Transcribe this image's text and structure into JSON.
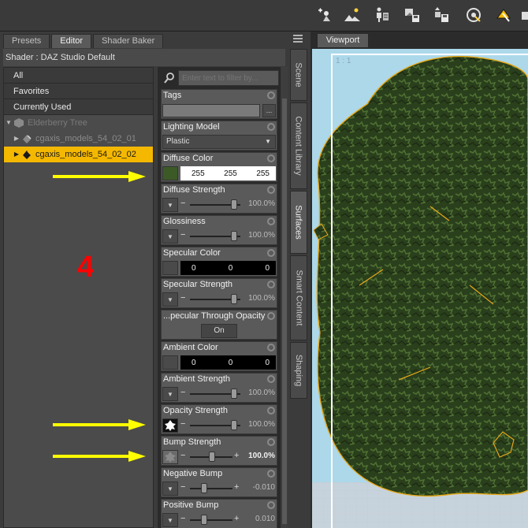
{
  "tabs": [
    {
      "label": "Presets"
    },
    {
      "label": "Editor"
    },
    {
      "label": "Shader Baker"
    }
  ],
  "shader_title": "Shader : DAZ Studio Default",
  "categories": [
    {
      "label": "All"
    },
    {
      "label": "Favorites"
    },
    {
      "label": "Currently Used"
    }
  ],
  "tree": [
    {
      "label": "Elderberry Tree"
    },
    {
      "label": "cgaxis_models_54_02_01"
    },
    {
      "label": "cgaxis_models_54_02_02"
    }
  ],
  "annotation_number": "4",
  "filter_placeholder": "Enter text to filter by...",
  "props": {
    "tags": {
      "label": "Tags",
      "button": "..."
    },
    "lighting_model": {
      "label": "Lighting Model",
      "value": "Plastic"
    },
    "diffuse_color": {
      "label": "Diffuse Color",
      "r": "255",
      "g": "255",
      "b": "255"
    },
    "diffuse_strength": {
      "label": "Diffuse Strength",
      "value": "100.0%"
    },
    "glossiness": {
      "label": "Glossiness",
      "value": "100.0%"
    },
    "specular_color": {
      "label": "Specular Color",
      "r": "0",
      "g": "0",
      "b": "0"
    },
    "specular_strength": {
      "label": "Specular Strength",
      "value": "100.0%"
    },
    "specular_through_opacity": {
      "label": "...pecular Through Opacity",
      "value": "On"
    },
    "ambient_color": {
      "label": "Ambient Color",
      "r": "0",
      "g": "0",
      "b": "0"
    },
    "ambient_strength": {
      "label": "Ambient Strength",
      "value": "100.0%"
    },
    "opacity_strength": {
      "label": "Opacity Strength",
      "value": "100.0%"
    },
    "bump_strength": {
      "label": "Bump Strength",
      "value": "100.0%"
    },
    "negative_bump": {
      "label": "Negative Bump",
      "value": "-0.010"
    },
    "positive_bump": {
      "label": "Positive Bump",
      "value": "0.010"
    }
  },
  "side_tabs": [
    {
      "label": "Scene"
    },
    {
      "label": "Content Library"
    },
    {
      "label": "Surfaces"
    },
    {
      "label": "Smart Content"
    },
    {
      "label": "Shaping"
    }
  ],
  "viewport": {
    "tab": "Viewport",
    "label": "1 : 1"
  },
  "colors": {
    "selection": "#f5b800",
    "annotation": "#ff0000",
    "arrow": "#ffff00",
    "sky": "#acd8ea",
    "leaf": "#2f4a1e"
  }
}
